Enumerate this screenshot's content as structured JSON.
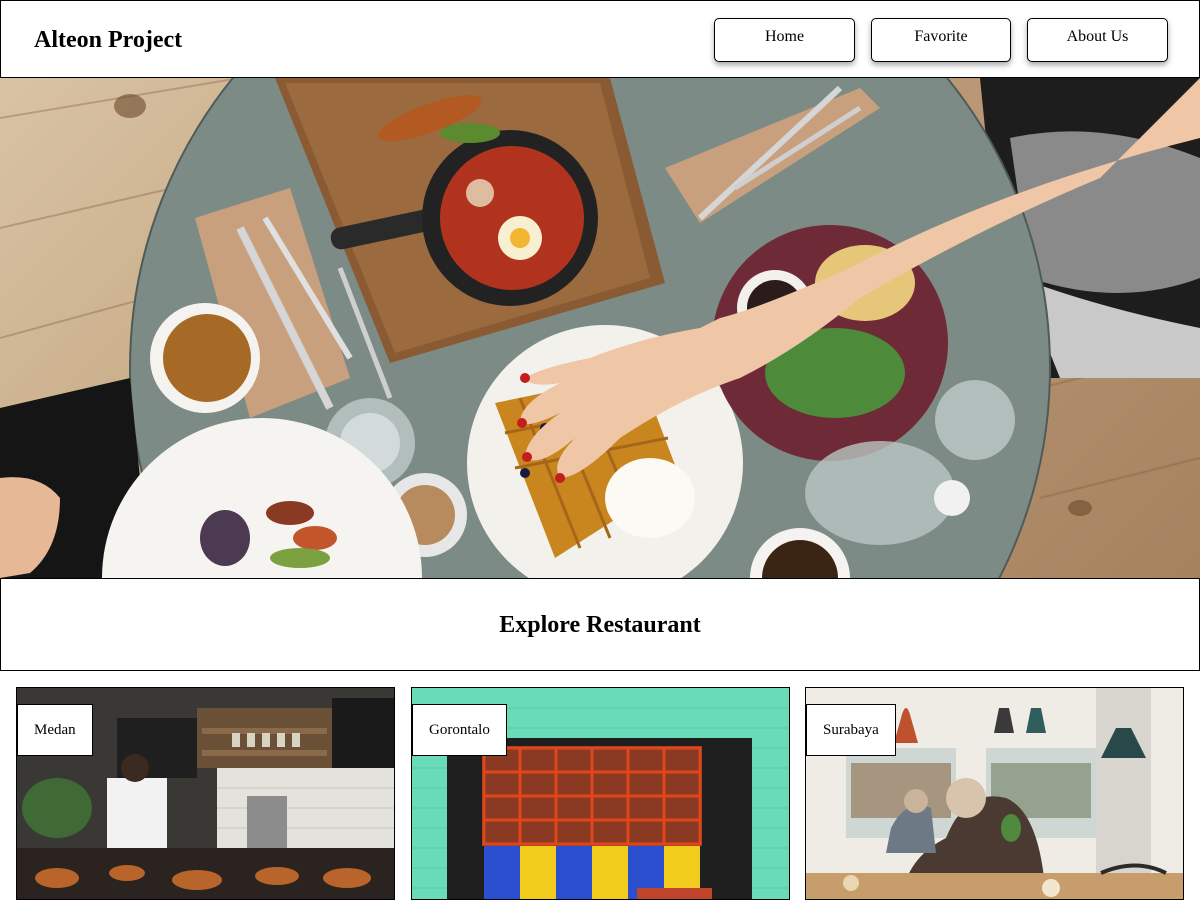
{
  "header": {
    "brand": "Alteon Project",
    "nav": {
      "home": "Home",
      "favorite": "Favorite",
      "about": "About Us"
    }
  },
  "hero": {
    "image": "hero-food-table-image"
  },
  "section": {
    "title": "Explore Restaurant"
  },
  "restaurants": [
    {
      "city": "Medan",
      "image": "restaurant-kitchen-image"
    },
    {
      "city": "Gorontalo",
      "image": "restaurant-storefront-image"
    },
    {
      "city": "Surabaya",
      "image": "restaurant-cafe-image"
    }
  ]
}
